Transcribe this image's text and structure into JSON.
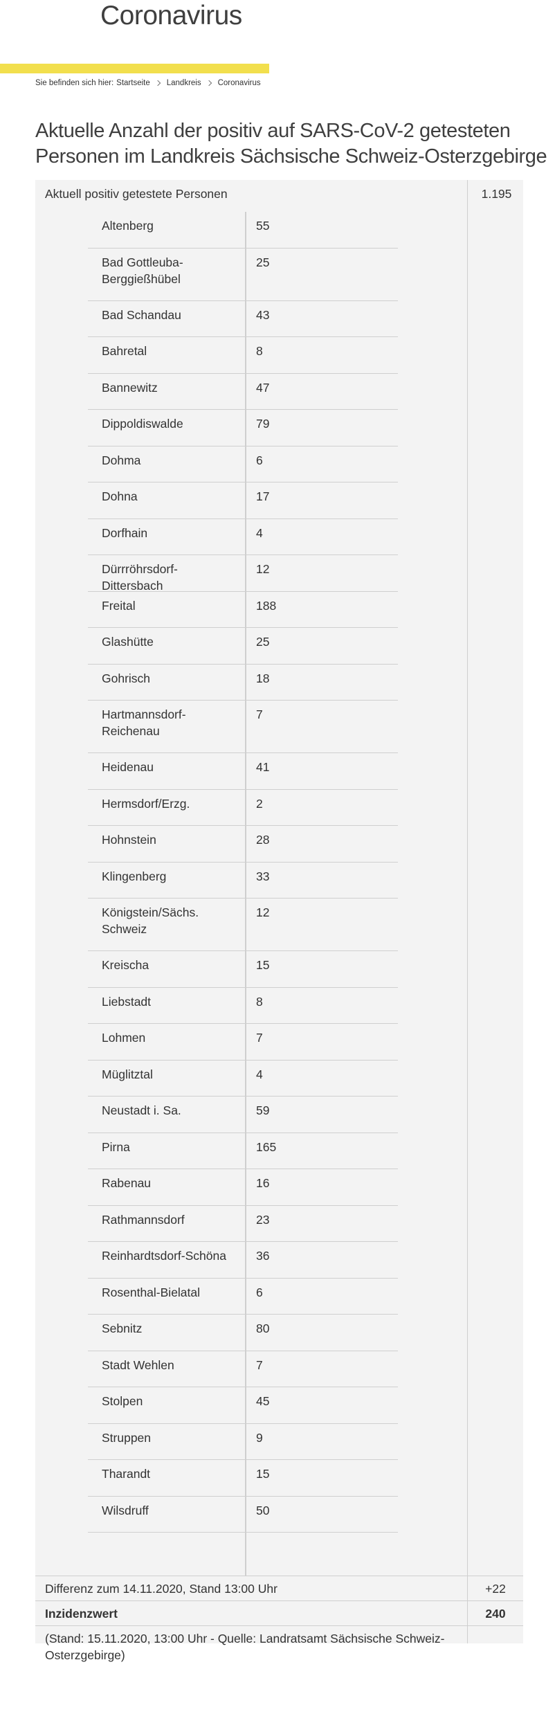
{
  "header": {
    "site_title": "Coronavirus"
  },
  "colors": {
    "accent_yellow": "#f2df4d",
    "panel_bg": "#f3f3f3",
    "divider": "#cfcfcf"
  },
  "breadcrumb": {
    "lead": "Sie befinden sich hier:",
    "items": [
      "Startseite",
      "Landkreis",
      "Coronavirus"
    ]
  },
  "page_title": "Aktuelle Anzahl der positiv auf SARS-CoV-2 getesteten Personen im Landkreis Sächsische Schweiz-Osterzgebirge",
  "table": {
    "total_label": "Aktuell positiv getestete Personen",
    "total_value": "1.195",
    "municipalities": [
      {
        "name": "Altenberg",
        "count": "55"
      },
      {
        "name": "Bad Gottleuba-Berggießhübel",
        "count": "25"
      },
      {
        "name": "Bad Schandau",
        "count": "43"
      },
      {
        "name": "Bahretal",
        "count": "8"
      },
      {
        "name": "Bannewitz",
        "count": "47"
      },
      {
        "name": "Dippoldiswalde",
        "count": "79"
      },
      {
        "name": "Dohma",
        "count": "6"
      },
      {
        "name": "Dohna",
        "count": "17"
      },
      {
        "name": "Dorfhain",
        "count": "4"
      },
      {
        "name": "Dürrröhrsdorf-Dittersbach",
        "count": "12"
      },
      {
        "name": "Freital",
        "count": "188"
      },
      {
        "name": "Glashütte",
        "count": "25"
      },
      {
        "name": "Gohrisch",
        "count": "18"
      },
      {
        "name": "Hartmannsdorf-Reichenau",
        "count": "7"
      },
      {
        "name": "Heidenau",
        "count": "41"
      },
      {
        "name": "Hermsdorf/Erzg.",
        "count": "2"
      },
      {
        "name": "Hohnstein",
        "count": "28"
      },
      {
        "name": "Klingenberg",
        "count": "33"
      },
      {
        "name": "Königstein/Sächs. Schweiz",
        "count": "12"
      },
      {
        "name": "Kreischa",
        "count": "15"
      },
      {
        "name": "Liebstadt",
        "count": "8"
      },
      {
        "name": "Lohmen",
        "count": "7"
      },
      {
        "name": "Müglitztal",
        "count": "4"
      },
      {
        "name": "Neustadt i. Sa.",
        "count": "59"
      },
      {
        "name": "Pirna",
        "count": "165"
      },
      {
        "name": "Rabenau",
        "count": "16"
      },
      {
        "name": "Rathmannsdorf",
        "count": "23"
      },
      {
        "name": "Reinhardtsdorf-Schöna",
        "count": "36"
      },
      {
        "name": "Rosenthal-Bielatal",
        "count": "6"
      },
      {
        "name": "Sebnitz",
        "count": "80"
      },
      {
        "name": "Stadt Wehlen",
        "count": "7"
      },
      {
        "name": "Stolpen",
        "count": "45"
      },
      {
        "name": "Struppen",
        "count": "9"
      },
      {
        "name": "Tharandt",
        "count": "15"
      },
      {
        "name": "Wilsdruff",
        "count": "50"
      }
    ],
    "diff_label": "Differenz zum 14.11.2020, Stand 13:00 Uhr",
    "diff_value": "+22",
    "incidence_label": "Inzidenzwert",
    "incidence_value": "240",
    "source_note": "(Stand: 15.11.2020, 13:00 Uhr - Quelle: Landratsamt Sächsische Schweiz-Osterzgebirge)"
  }
}
